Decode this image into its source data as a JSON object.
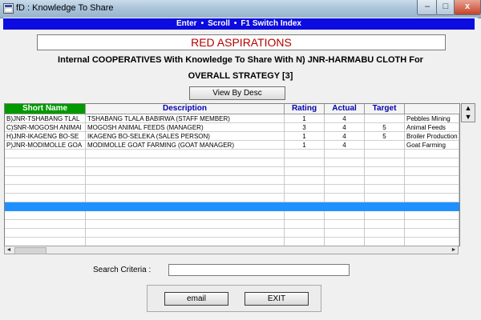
{
  "window": {
    "title": "fD : Knowledge To Share"
  },
  "window_controls": {
    "min": "–",
    "max": "□",
    "close": "x"
  },
  "hint_bar": {
    "items": [
      "Enter",
      "Scroll",
      "F1 Switch Index"
    ],
    "bullet": "•"
  },
  "heading": "RED ASPIRATIONS",
  "subtitle_line1": "Internal COOPERATIVES With Knowledge To Share With N) JNR-HARMABU CLOTH For",
  "subtitle_line2": "OVERALL STRATEGY   [3]",
  "view_button": "View By Desc",
  "grid": {
    "columns": [
      "Short Name",
      "Description",
      "Rating",
      "Actual",
      "Target",
      ""
    ],
    "rows": [
      [
        "B)JNR-TSHABANG TLAL",
        "TSHABANG TLALA BABIRWA (STAFF MEMBER)",
        "1",
        "4",
        "",
        "Pebbles Mining"
      ],
      [
        "C)SNR-MOGOSH ANIMAI",
        "MOGOSH ANIMAL FEEDS (MANAGER)",
        "3",
        "4",
        "5",
        "Animal Feeds"
      ],
      [
        "H)JNR-IKAGENG BO-SE",
        "IKAGENG BO-SELEKA (SALES PERSON)",
        "1",
        "4",
        "5",
        "Broiler Production"
      ],
      [
        "P)JNR-MODIMOLLE GOA",
        "MODIMOLLE GOAT FARMING (GOAT MANAGER)",
        "1",
        "4",
        "",
        "Goat Farming"
      ]
    ]
  },
  "scroll_arrows": {
    "up": "▲",
    "down": "▼",
    "left": "◄",
    "right": "►"
  },
  "search": {
    "label": "Search  Criteria :",
    "value": ""
  },
  "buttons": {
    "email": "email",
    "exit": "EXIT"
  },
  "colors": {
    "hint_bar": "#0c0ce0",
    "heading_text": "#b40000",
    "short_name_header": "#009a00",
    "header_text": "#0000b0",
    "selected_row": "#1e90ff"
  }
}
